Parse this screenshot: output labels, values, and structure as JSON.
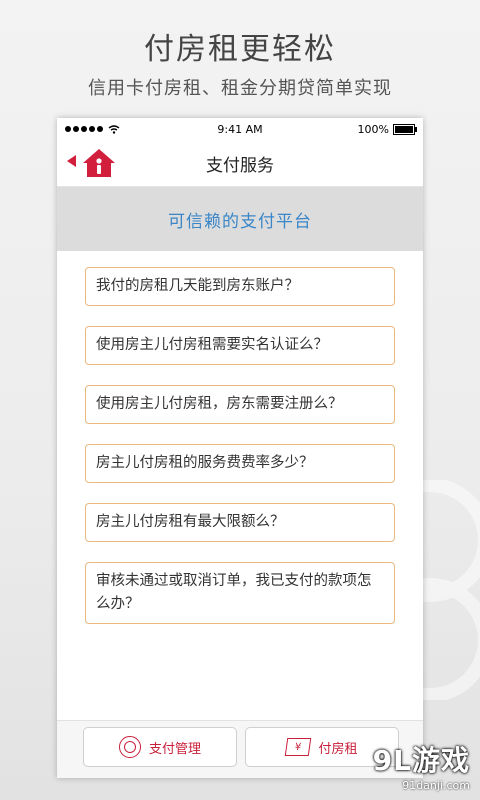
{
  "promo": {
    "title": "付房租更轻松",
    "subtitle": "信用卡付房租、租金分期贷简单实现"
  },
  "statusbar": {
    "time": "9:41 AM",
    "battery": "100%",
    "battery_level": 1.0
  },
  "navbar": {
    "title": "支付服务",
    "icons": [
      "back-arrow-icon",
      "house-logo-icon"
    ]
  },
  "banner": {
    "text": "可信赖的支付平台"
  },
  "faq": [
    {
      "text": "我付的房租几天能到房东账户？"
    },
    {
      "text": "使用房主儿付房租需要实名认证么？"
    },
    {
      "text": "使用房主儿付房租，房东需要注册么？"
    },
    {
      "text": "房主儿付房租的服务费费率多少？"
    },
    {
      "text": "房主儿付房租有最大限额么？"
    },
    {
      "text": "审核未通过或取消订单，我已支付的款项怎么办？"
    }
  ],
  "bottombar": {
    "pay_manage": "支付管理",
    "pay_rent": "付房租"
  },
  "brand": {
    "main": "9L游戏",
    "url": "91danji.com"
  },
  "colors": {
    "accent": "#c8203a",
    "banner_text": "#3a86c8",
    "faq_border": "#e9b97e"
  }
}
